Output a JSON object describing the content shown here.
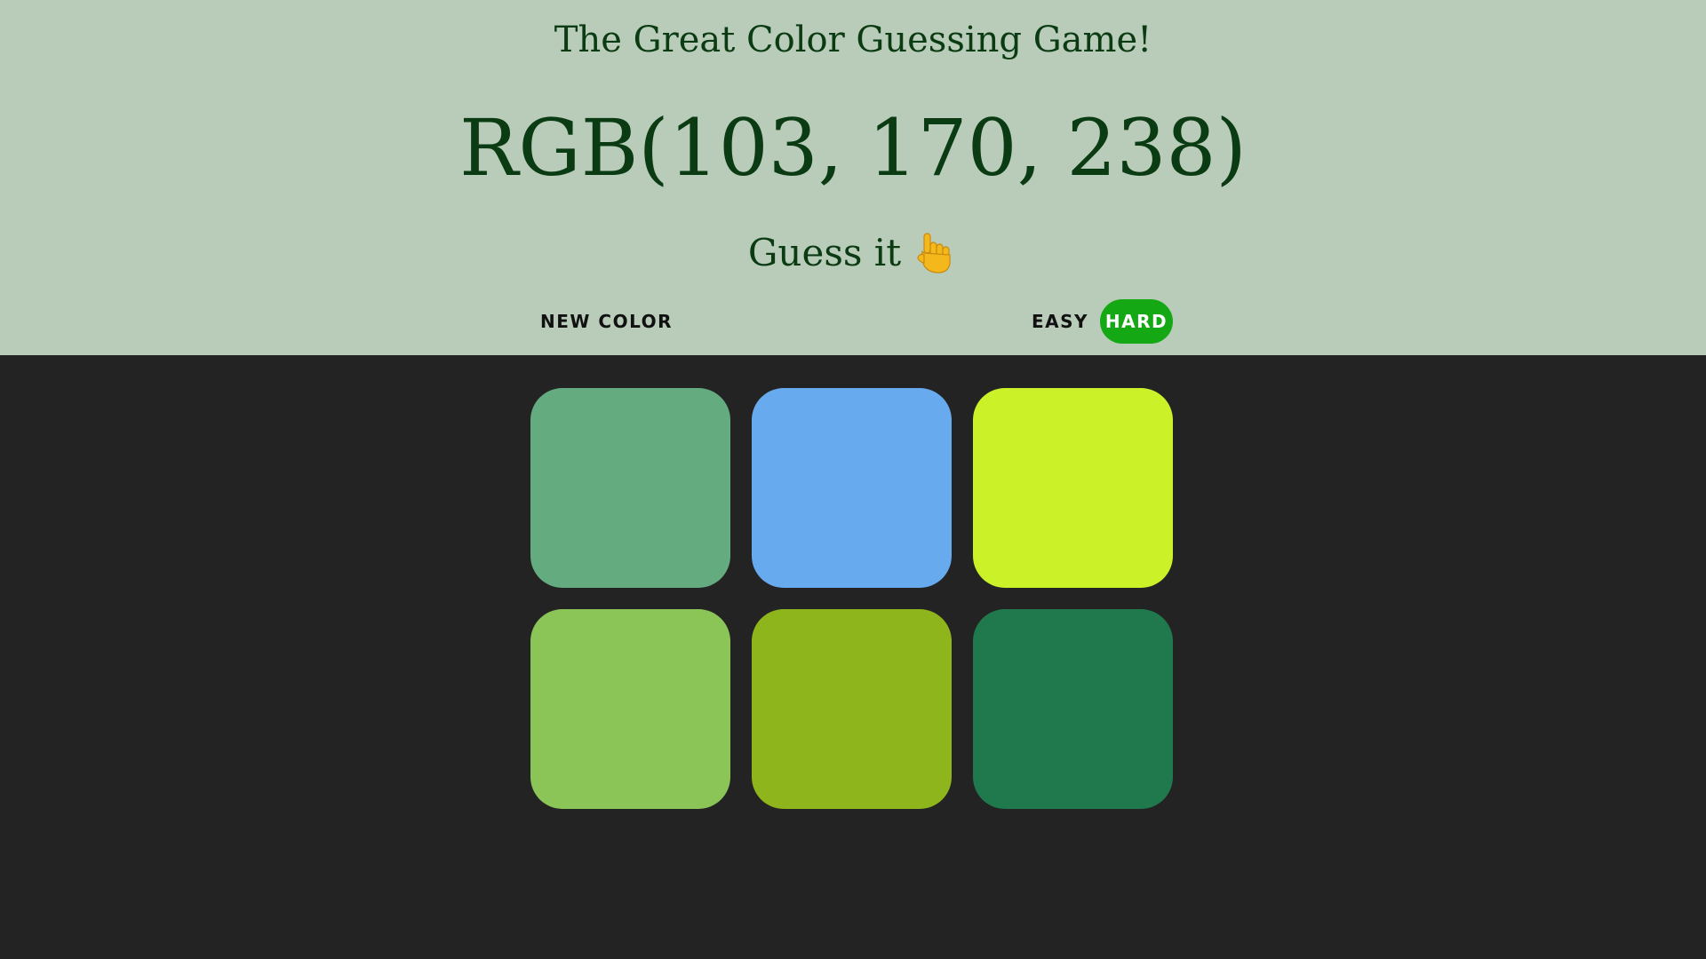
{
  "header": {
    "title": "The Great Color Guessing Game!",
    "rgb_display": "RGB(103, 170, 238)",
    "message": "Guess it",
    "message_icon": "pointing-hand-icon",
    "background_color": "#b8ccb9",
    "text_color": "#0b3b12"
  },
  "controls": {
    "new_color_label": "NEW COLOR",
    "easy_label": "EASY",
    "hard_label": "HARD",
    "selected_mode": "HARD",
    "accent_color": "#14a914"
  },
  "board": {
    "background_color": "#232323",
    "squares": [
      {
        "color": "#65ab80"
      },
      {
        "color": "#67aaee"
      },
      {
        "color": "#cbf229"
      },
      {
        "color": "#8bc457"
      },
      {
        "color": "#8fb51d"
      },
      {
        "color": "#1f794d"
      }
    ]
  }
}
